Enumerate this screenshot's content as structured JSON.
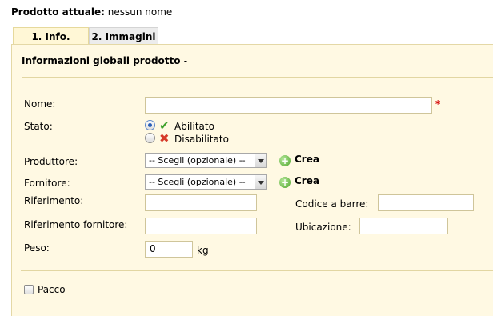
{
  "header": {
    "prefix": "Prodotto attuale:",
    "value": "nessun nome"
  },
  "tabs": [
    {
      "label": "1. Info.",
      "active": true
    },
    {
      "label": "2. Immagini",
      "active": false
    }
  ],
  "panel": {
    "title": "Informazioni globali prodotto",
    "title_suffix": "-"
  },
  "form": {
    "name": {
      "label": "Nome:",
      "value": "",
      "required_mark": "*"
    },
    "status": {
      "label": "Stato:",
      "options": [
        {
          "label": "Abilitato",
          "selected": true,
          "icon": "check-icon"
        },
        {
          "label": "Disabilitato",
          "selected": false,
          "icon": "cross-icon"
        }
      ]
    },
    "manufacturer": {
      "label": "Produttore:",
      "selected": "-- Scegli (opzionale) --",
      "create_label": "Crea"
    },
    "supplier": {
      "label": "Fornitore:",
      "selected": "-- Scegli (opzionale) --",
      "create_label": "Crea"
    },
    "reference": {
      "label": "Riferimento:",
      "value": ""
    },
    "barcode": {
      "label": "Codice a barre:",
      "value": ""
    },
    "supplier_reference": {
      "label": "Riferimento fornitore:",
      "value": ""
    },
    "location": {
      "label": "Ubicazione:",
      "value": ""
    },
    "weight": {
      "label": "Peso:",
      "value": "0",
      "unit": "kg"
    },
    "pack": {
      "label": "Pacco",
      "checked": false
    }
  },
  "colors": {
    "panel_bg": "#fff9e3",
    "required": "#d40000",
    "enabled_icon": "#3ea12c",
    "disabled_icon": "#d63a2a"
  }
}
